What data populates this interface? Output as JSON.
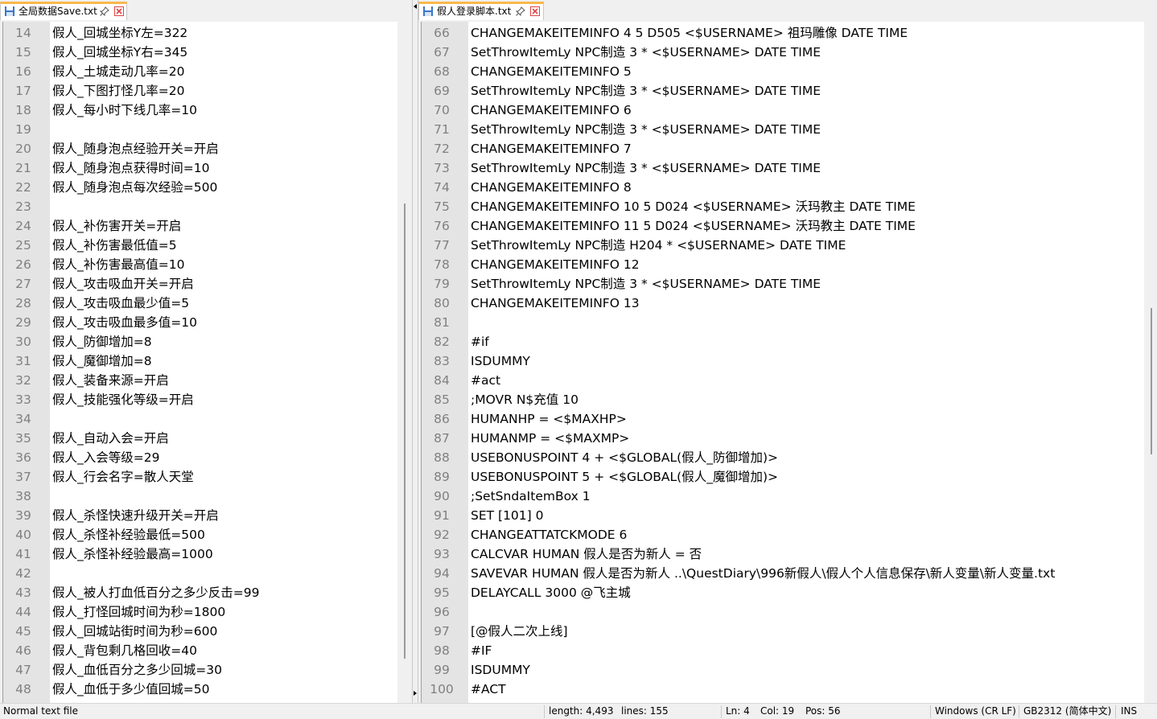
{
  "left_tab": {
    "label": "全局数据Save.txt"
  },
  "right_tab": {
    "label": "假人登录脚本.txt"
  },
  "left_editor": {
    "lines": [
      {
        "n": "14",
        "t": "假人_回城坐标Y左=322"
      },
      {
        "n": "15",
        "t": "假人_回城坐标Y右=345"
      },
      {
        "n": "16",
        "t": "假人_土城走动几率=20"
      },
      {
        "n": "17",
        "t": "假人_下图打怪几率=20"
      },
      {
        "n": "18",
        "t": "假人_每小时下线几率=10"
      },
      {
        "n": "19",
        "t": ""
      },
      {
        "n": "20",
        "t": "假人_随身泡点经验开关=开启"
      },
      {
        "n": "21",
        "t": "假人_随身泡点获得时间=10"
      },
      {
        "n": "22",
        "t": "假人_随身泡点每次经验=500"
      },
      {
        "n": "23",
        "t": ""
      },
      {
        "n": "24",
        "t": "假人_补伤害开关=开启"
      },
      {
        "n": "25",
        "t": "假人_补伤害最低值=5"
      },
      {
        "n": "26",
        "t": "假人_补伤害最高值=10"
      },
      {
        "n": "27",
        "t": "假人_攻击吸血开关=开启"
      },
      {
        "n": "28",
        "t": "假人_攻击吸血最少值=5"
      },
      {
        "n": "29",
        "t": "假人_攻击吸血最多值=10"
      },
      {
        "n": "30",
        "t": "假人_防御增加=8"
      },
      {
        "n": "31",
        "t": "假人_魔御增加=8"
      },
      {
        "n": "32",
        "t": "假人_装备来源=开启"
      },
      {
        "n": "33",
        "t": "假人_技能强化等级=开启"
      },
      {
        "n": "34",
        "t": ""
      },
      {
        "n": "35",
        "t": "假人_自动入会=开启"
      },
      {
        "n": "36",
        "t": "假人_入会等级=29"
      },
      {
        "n": "37",
        "t": "假人_行会名字=散人天堂"
      },
      {
        "n": "38",
        "t": ""
      },
      {
        "n": "39",
        "t": "假人_杀怪快速升级开关=开启"
      },
      {
        "n": "40",
        "t": "假人_杀怪补经验最低=500"
      },
      {
        "n": "41",
        "t": "假人_杀怪补经验最高=1000"
      },
      {
        "n": "42",
        "t": ""
      },
      {
        "n": "43",
        "t": "假人_被人打血低百分之多少反击=99"
      },
      {
        "n": "44",
        "t": "假人_打怪回城时间为秒=1800"
      },
      {
        "n": "45",
        "t": "假人_回城站街时间为秒=600"
      },
      {
        "n": "46",
        "t": "假人_背包剩几格回收=40"
      },
      {
        "n": "47",
        "t": "假人_血低百分之多少回城=30"
      },
      {
        "n": "48",
        "t": "假人_血低于多少值回城=50"
      }
    ]
  },
  "right_editor": {
    "lines": [
      {
        "n": "66",
        "t": "CHANGEMAKEITEMINFO 4 5 D505 <$USERNAME> 祖玛雕像 DATE TIME"
      },
      {
        "n": "67",
        "t": "SetThrowItemLy NPC制造 3 * <$USERNAME> DATE TIME"
      },
      {
        "n": "68",
        "t": "CHANGEMAKEITEMINFO 5"
      },
      {
        "n": "69",
        "t": "SetThrowItemLy NPC制造 3 * <$USERNAME> DATE TIME"
      },
      {
        "n": "70",
        "t": "CHANGEMAKEITEMINFO 6"
      },
      {
        "n": "71",
        "t": "SetThrowItemLy NPC制造 3 * <$USERNAME> DATE TIME"
      },
      {
        "n": "72",
        "t": "CHANGEMAKEITEMINFO 7"
      },
      {
        "n": "73",
        "t": "SetThrowItemLy NPC制造 3 * <$USERNAME> DATE TIME"
      },
      {
        "n": "74",
        "t": "CHANGEMAKEITEMINFO 8"
      },
      {
        "n": "75",
        "t": "CHANGEMAKEITEMINFO 10 5 D024 <$USERNAME> 沃玛教主 DATE TIME"
      },
      {
        "n": "76",
        "t": "CHANGEMAKEITEMINFO 11 5 D024 <$USERNAME> 沃玛教主 DATE TIME"
      },
      {
        "n": "77",
        "t": "SetThrowItemLy NPC制造 H204 * <$USERNAME> DATE TIME"
      },
      {
        "n": "78",
        "t": "CHANGEMAKEITEMINFO 12"
      },
      {
        "n": "79",
        "t": "SetThrowItemLy NPC制造 3 * <$USERNAME> DATE TIME"
      },
      {
        "n": "80",
        "t": "CHANGEMAKEITEMINFO 13"
      },
      {
        "n": "81",
        "t": ""
      },
      {
        "n": "82",
        "t": "#if"
      },
      {
        "n": "83",
        "t": "ISDUMMY"
      },
      {
        "n": "84",
        "t": "#act"
      },
      {
        "n": "85",
        "t": ";MOVR N$充值 10"
      },
      {
        "n": "86",
        "t": "HUMANHP = <$MAXHP>"
      },
      {
        "n": "87",
        "t": "HUMANMP = <$MAXMP>"
      },
      {
        "n": "88",
        "t": "USEBONUSPOINT 4 + <$GLOBAL(假人_防御增加)>"
      },
      {
        "n": "89",
        "t": "USEBONUSPOINT 5 + <$GLOBAL(假人_魔御增加)>"
      },
      {
        "n": "90",
        "t": ";SetSndaItemBox 1"
      },
      {
        "n": "91",
        "t": "SET [101] 0"
      },
      {
        "n": "92",
        "t": "CHANGEATTATCKMODE 6"
      },
      {
        "n": "93",
        "t": "CALCVAR HUMAN 假人是否为新人 = 否"
      },
      {
        "n": "94",
        "t": "SAVEVAR HUMAN 假人是否为新人 ..\\QuestDiary\\996新假人\\假人个人信息保存\\新人变量\\新人变量.txt"
      },
      {
        "n": "95",
        "t": "DELAYCALL 3000 @飞主城"
      },
      {
        "n": "96",
        "t": ""
      },
      {
        "n": "97",
        "t": "[@假人二次上线]"
      },
      {
        "n": "98",
        "t": "#IF"
      },
      {
        "n": "99",
        "t": "ISDUMMY"
      },
      {
        "n": "100",
        "t": "#ACT"
      }
    ]
  },
  "statusbar": {
    "file_type": "Normal text file",
    "length": "length: 4,493",
    "lines": "lines: 155",
    "ln": "Ln: 4",
    "col": "Col: 19",
    "pos": "Pos: 56",
    "eol": "Windows (CR LF)",
    "encoding": "GB2312 (简体中文)",
    "mode": "INS"
  },
  "colors": {
    "tab_accent": "#fab84b",
    "gutter_bg": "#e4e4e4",
    "line_number": "#808080",
    "close_icon": "#e04343",
    "save_icon": "#3b76c4"
  }
}
